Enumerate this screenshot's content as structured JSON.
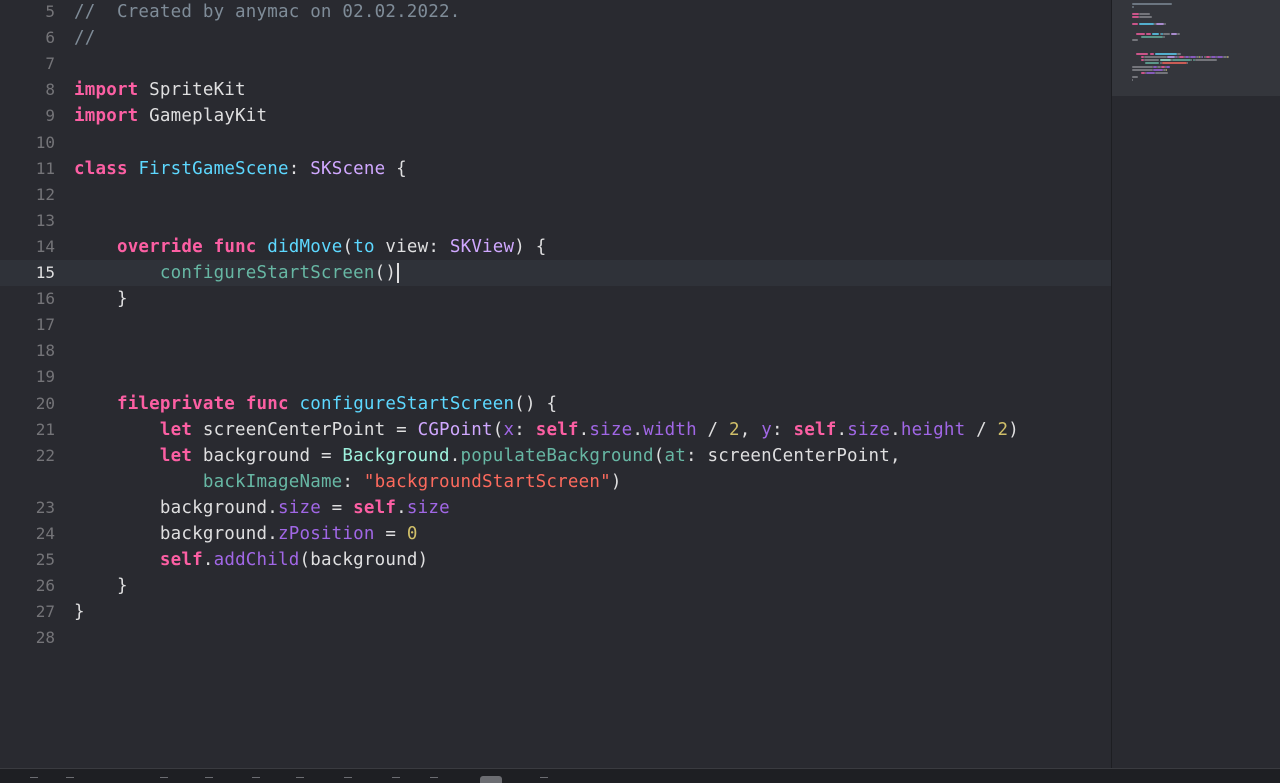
{
  "editor": {
    "current_line": 15,
    "lines": [
      {
        "no": "5",
        "tokens": [
          {
            "t": "//  Created by anymac on 02.02.2022.",
            "c": "cmt"
          }
        ]
      },
      {
        "no": "6",
        "tokens": [
          {
            "t": "//",
            "c": "cmt"
          }
        ]
      },
      {
        "no": "7",
        "tokens": []
      },
      {
        "no": "8",
        "tokens": [
          {
            "t": "import",
            "c": "kw"
          },
          {
            "t": " SpriteKit",
            "c": "plain"
          }
        ]
      },
      {
        "no": "9",
        "tokens": [
          {
            "t": "import",
            "c": "kw"
          },
          {
            "t": " GameplayKit",
            "c": "plain"
          }
        ]
      },
      {
        "no": "10",
        "tokens": []
      },
      {
        "no": "11",
        "tokens": [
          {
            "t": "class",
            "c": "kw"
          },
          {
            "t": " ",
            "c": "plain"
          },
          {
            "t": "FirstGameScene",
            "c": "decl"
          },
          {
            "t": ": ",
            "c": "plain"
          },
          {
            "t": "SKScene",
            "c": "type"
          },
          {
            "t": " {",
            "c": "plain"
          }
        ]
      },
      {
        "no": "12",
        "tokens": []
      },
      {
        "no": "13",
        "tokens": []
      },
      {
        "no": "14",
        "tokens": [
          {
            "t": "    ",
            "c": "plain"
          },
          {
            "t": "override",
            "c": "kw"
          },
          {
            "t": " ",
            "c": "plain"
          },
          {
            "t": "func",
            "c": "kw"
          },
          {
            "t": " ",
            "c": "plain"
          },
          {
            "t": "didMove",
            "c": "decl"
          },
          {
            "t": "(",
            "c": "plain"
          },
          {
            "t": "to",
            "c": "decl"
          },
          {
            "t": " view: ",
            "c": "plain"
          },
          {
            "t": "SKView",
            "c": "type"
          },
          {
            "t": ") {",
            "c": "plain"
          }
        ]
      },
      {
        "no": "15",
        "tokens": [
          {
            "t": "        ",
            "c": "plain"
          },
          {
            "t": "configureStartScreen",
            "c": "call"
          },
          {
            "t": "()",
            "c": "plain"
          }
        ],
        "caret": true
      },
      {
        "no": "16",
        "tokens": [
          {
            "t": "    }",
            "c": "plain"
          }
        ]
      },
      {
        "no": "17",
        "tokens": []
      },
      {
        "no": "18",
        "tokens": []
      },
      {
        "no": "19",
        "tokens": []
      },
      {
        "no": "20",
        "tokens": [
          {
            "t": "    ",
            "c": "plain"
          },
          {
            "t": "fileprivate",
            "c": "kw"
          },
          {
            "t": " ",
            "c": "plain"
          },
          {
            "t": "func",
            "c": "kw"
          },
          {
            "t": " ",
            "c": "plain"
          },
          {
            "t": "configureStartScreen",
            "c": "decl"
          },
          {
            "t": "() {",
            "c": "plain"
          }
        ]
      },
      {
        "no": "21",
        "tokens": [
          {
            "t": "        ",
            "c": "plain"
          },
          {
            "t": "let",
            "c": "kw"
          },
          {
            "t": " screenCenterPoint = ",
            "c": "plain"
          },
          {
            "t": "CGPoint",
            "c": "type"
          },
          {
            "t": "(",
            "c": "plain"
          },
          {
            "t": "x",
            "c": "mem"
          },
          {
            "t": ": ",
            "c": "plain"
          },
          {
            "t": "self",
            "c": "kw"
          },
          {
            "t": ".",
            "c": "plain"
          },
          {
            "t": "size",
            "c": "mem"
          },
          {
            "t": ".",
            "c": "plain"
          },
          {
            "t": "width",
            "c": "mem"
          },
          {
            "t": " / ",
            "c": "plain"
          },
          {
            "t": "2",
            "c": "num"
          },
          {
            "t": ", ",
            "c": "plain"
          },
          {
            "t": "y",
            "c": "mem"
          },
          {
            "t": ": ",
            "c": "plain"
          },
          {
            "t": "self",
            "c": "kw"
          },
          {
            "t": ".",
            "c": "plain"
          },
          {
            "t": "size",
            "c": "mem"
          },
          {
            "t": ".",
            "c": "plain"
          },
          {
            "t": "height",
            "c": "mem"
          },
          {
            "t": " / ",
            "c": "plain"
          },
          {
            "t": "2",
            "c": "num"
          },
          {
            "t": ")",
            "c": "plain"
          }
        ]
      },
      {
        "no": "22",
        "tokens": [
          {
            "t": "        ",
            "c": "plain"
          },
          {
            "t": "let",
            "c": "kw"
          },
          {
            "t": " background = ",
            "c": "plain"
          },
          {
            "t": "Background",
            "c": "cls"
          },
          {
            "t": ".",
            "c": "plain"
          },
          {
            "t": "populateBackground",
            "c": "call"
          },
          {
            "t": "(",
            "c": "plain"
          },
          {
            "t": "at",
            "c": "call"
          },
          {
            "t": ": screenCenterPoint,",
            "c": "plain"
          }
        ]
      },
      {
        "no": "",
        "tokens": [
          {
            "t": "            ",
            "c": "plain"
          },
          {
            "t": "backImageName",
            "c": "call"
          },
          {
            "t": ": ",
            "c": "plain"
          },
          {
            "t": "\"backgroundStartScreen\"",
            "c": "str"
          },
          {
            "t": ")",
            "c": "plain"
          }
        ]
      },
      {
        "no": "23",
        "tokens": [
          {
            "t": "        background.",
            "c": "plain"
          },
          {
            "t": "size",
            "c": "mem"
          },
          {
            "t": " = ",
            "c": "plain"
          },
          {
            "t": "self",
            "c": "kw"
          },
          {
            "t": ".",
            "c": "plain"
          },
          {
            "t": "size",
            "c": "mem"
          }
        ]
      },
      {
        "no": "24",
        "tokens": [
          {
            "t": "        background.",
            "c": "plain"
          },
          {
            "t": "zPosition",
            "c": "mem"
          },
          {
            "t": " = ",
            "c": "plain"
          },
          {
            "t": "0",
            "c": "num"
          }
        ]
      },
      {
        "no": "25",
        "tokens": [
          {
            "t": "        ",
            "c": "plain"
          },
          {
            "t": "self",
            "c": "kw"
          },
          {
            "t": ".",
            "c": "plain"
          },
          {
            "t": "addChild",
            "c": "mem"
          },
          {
            "t": "(background)",
            "c": "plain"
          }
        ]
      },
      {
        "no": "26",
        "tokens": [
          {
            "t": "    }",
            "c": "plain"
          }
        ]
      },
      {
        "no": "27",
        "tokens": [
          {
            "t": "}",
            "c": "plain"
          }
        ]
      },
      {
        "no": "28",
        "tokens": []
      }
    ]
  },
  "theme": {
    "background": "#292a30",
    "current_line_background": "#2f3239",
    "keyword": "#fc5fa3",
    "comment": "#7f8c98",
    "type": "#d0a8ff",
    "declaration": "#5dd8ff",
    "function_call": "#67b7a4",
    "member": "#a167e6",
    "number": "#d0bf69",
    "string": "#fc6a5d"
  },
  "minimap": {
    "visible": true
  },
  "bottom_toolbar": {
    "icons": [
      "hide-panel-icon",
      "breakpoint-icon",
      "continue-icon",
      "step-over-icon",
      "step-into-icon",
      "step-out-icon",
      "view-hierarchy-icon",
      "memory-graph-icon",
      "environment-icon",
      "location-icon",
      "frame-icon"
    ]
  }
}
